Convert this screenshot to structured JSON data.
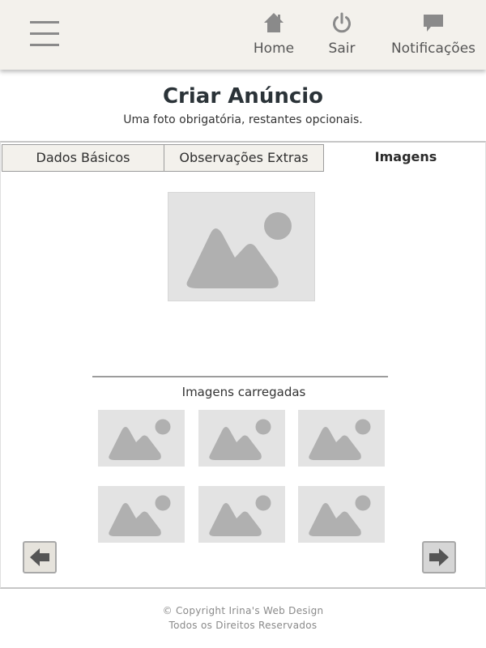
{
  "header": {
    "menu_icon": "hamburger-menu-icon",
    "nav": [
      {
        "label": "Home",
        "icon": "house-icon"
      },
      {
        "label": "Sair",
        "icon": "power-icon"
      },
      {
        "label": "Notificações",
        "icon": "speech-bubble-icon"
      }
    ]
  },
  "page": {
    "title": "Criar Anúncio",
    "subtitle": "Uma foto obrigatória, restantes opcionais."
  },
  "tabs": [
    {
      "label": "Dados Básicos",
      "active": false
    },
    {
      "label": "Observações Extras",
      "active": false
    },
    {
      "label": "Imagens",
      "active": true
    }
  ],
  "images": {
    "main_icon": "image-placeholder-icon",
    "uploaded_label": "Imagens carregadas",
    "thumbnail_count_shown": 6
  },
  "navigation": {
    "prev_icon": "arrow-left-icon",
    "next_icon": "arrow-right-icon"
  },
  "footer": {
    "line1": "© Copyright Irina's Web Design",
    "line2": "Todos os Direitos Reservados"
  },
  "colors": {
    "header_bg": "#f3f1ec",
    "placeholder_bg": "#e3e3e3",
    "placeholder_shape": "#b0b0b0",
    "title": "#2b3338"
  }
}
